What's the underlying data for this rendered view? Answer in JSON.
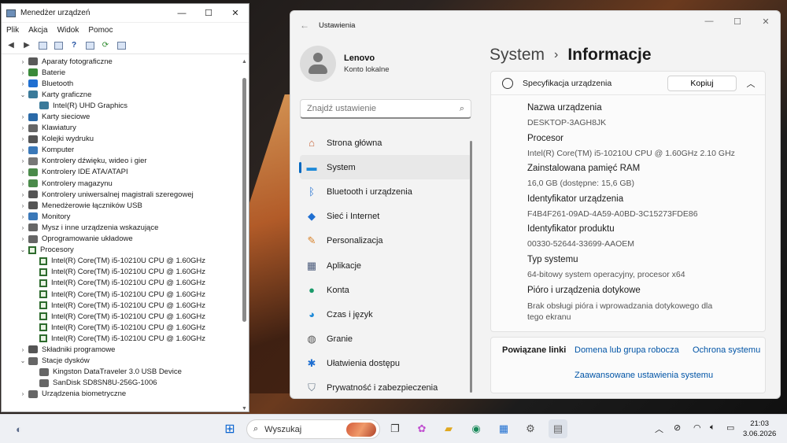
{
  "device_manager": {
    "title": "Menedżer urządzeń",
    "menu": [
      "Plik",
      "Akcja",
      "Widok",
      "Pomoc"
    ],
    "tree": [
      {
        "label": "Aparaty fotograficzne",
        "level": 0,
        "expanded": false,
        "icon": "camera-icon",
        "color": "#5a5a5a"
      },
      {
        "label": "Baterie",
        "level": 0,
        "expanded": false,
        "icon": "battery-icon",
        "color": "#3a8a3a"
      },
      {
        "label": "Bluetooth",
        "level": 0,
        "expanded": false,
        "icon": "bluetooth-icon",
        "color": "#1f6fd1"
      },
      {
        "label": "Karty graficzne",
        "level": 0,
        "expanded": true,
        "icon": "display-adapter-icon",
        "color": "#3a7a9a"
      },
      {
        "label": "Intel(R) UHD Graphics",
        "level": 1,
        "expanded": null,
        "icon": "display-adapter-icon",
        "color": "#3a7a9a"
      },
      {
        "label": "Karty sieciowe",
        "level": 0,
        "expanded": false,
        "icon": "network-icon",
        "color": "#2a6aa8"
      },
      {
        "label": "Klawiatury",
        "level": 0,
        "expanded": false,
        "icon": "keyboard-icon",
        "color": "#666666"
      },
      {
        "label": "Kolejki wydruku",
        "level": 0,
        "expanded": false,
        "icon": "printer-icon",
        "color": "#555555"
      },
      {
        "label": "Komputer",
        "level": 0,
        "expanded": false,
        "icon": "computer-icon",
        "color": "#3a78b8"
      },
      {
        "label": "Kontrolery dźwięku, wideo i gier",
        "level": 0,
        "expanded": false,
        "icon": "audio-icon",
        "color": "#777777"
      },
      {
        "label": "Kontrolery IDE ATA/ATAPI",
        "level": 0,
        "expanded": false,
        "icon": "ide-icon",
        "color": "#4a8a4a"
      },
      {
        "label": "Kontrolery magazynu",
        "level": 0,
        "expanded": false,
        "icon": "storage-controller-icon",
        "color": "#4a8a4a"
      },
      {
        "label": "Kontrolery uniwersalnej magistrali szeregowej",
        "level": 0,
        "expanded": false,
        "icon": "usb-icon",
        "color": "#555555"
      },
      {
        "label": "Menedżerowie łączników USB",
        "level": 0,
        "expanded": false,
        "icon": "usb-icon",
        "color": "#555555"
      },
      {
        "label": "Monitory",
        "level": 0,
        "expanded": false,
        "icon": "monitor-icon",
        "color": "#3a78b8"
      },
      {
        "label": "Mysz i inne urządzenia wskazujące",
        "level": 0,
        "expanded": false,
        "icon": "mouse-icon",
        "color": "#666666"
      },
      {
        "label": "Oprogramowanie układowe",
        "level": 0,
        "expanded": false,
        "icon": "firmware-icon",
        "color": "#666666"
      },
      {
        "label": "Procesory",
        "level": 0,
        "expanded": true,
        "icon": "processor-icon",
        "color": "#2d6b2d"
      },
      {
        "label": "Intel(R) Core(TM) i5-10210U CPU @ 1.60GHz",
        "level": 1,
        "expanded": null,
        "icon": "processor-icon",
        "color": "#2d6b2d"
      },
      {
        "label": "Intel(R) Core(TM) i5-10210U CPU @ 1.60GHz",
        "level": 1,
        "expanded": null,
        "icon": "processor-icon",
        "color": "#2d6b2d"
      },
      {
        "label": "Intel(R) Core(TM) i5-10210U CPU @ 1.60GHz",
        "level": 1,
        "expanded": null,
        "icon": "processor-icon",
        "color": "#2d6b2d"
      },
      {
        "label": "Intel(R) Core(TM) i5-10210U CPU @ 1.60GHz",
        "level": 1,
        "expanded": null,
        "icon": "processor-icon",
        "color": "#2d6b2d"
      },
      {
        "label": "Intel(R) Core(TM) i5-10210U CPU @ 1.60GHz",
        "level": 1,
        "expanded": null,
        "icon": "processor-icon",
        "color": "#2d6b2d"
      },
      {
        "label": "Intel(R) Core(TM) i5-10210U CPU @ 1.60GHz",
        "level": 1,
        "expanded": null,
        "icon": "processor-icon",
        "color": "#2d6b2d"
      },
      {
        "label": "Intel(R) Core(TM) i5-10210U CPU @ 1.60GHz",
        "level": 1,
        "expanded": null,
        "icon": "processor-icon",
        "color": "#2d6b2d"
      },
      {
        "label": "Intel(R) Core(TM) i5-10210U CPU @ 1.60GHz",
        "level": 1,
        "expanded": null,
        "icon": "processor-icon",
        "color": "#2d6b2d"
      },
      {
        "label": "Składniki programowe",
        "level": 0,
        "expanded": false,
        "icon": "software-component-icon",
        "color": "#555555"
      },
      {
        "label": "Stacje dysków",
        "level": 0,
        "expanded": true,
        "icon": "disk-drive-icon",
        "color": "#666666"
      },
      {
        "label": "Kingston DataTraveler 3.0 USB Device",
        "level": 1,
        "expanded": null,
        "icon": "disk-drive-icon",
        "color": "#666666"
      },
      {
        "label": "SanDisk SD8SN8U-256G-1006",
        "level": 1,
        "expanded": null,
        "icon": "disk-drive-icon",
        "color": "#666666"
      },
      {
        "label": "Urządzenia biometryczne",
        "level": 0,
        "expanded": false,
        "icon": "biometric-icon",
        "color": "#666666"
      }
    ]
  },
  "settings": {
    "title": "Ustawienia",
    "user": {
      "name": "Lenovo",
      "account_type": "Konto lokalne"
    },
    "search_placeholder": "Znajdź ustawienie",
    "nav": [
      {
        "label": "Strona główna",
        "icon": "home-icon",
        "selected": false
      },
      {
        "label": "System",
        "icon": "system-icon",
        "selected": true
      },
      {
        "label": "Bluetooth i urządzenia",
        "icon": "bluetooth-icon",
        "selected": false
      },
      {
        "label": "Sieć i Internet",
        "icon": "wifi-icon",
        "selected": false
      },
      {
        "label": "Personalizacja",
        "icon": "brush-icon",
        "selected": false
      },
      {
        "label": "Aplikacje",
        "icon": "apps-icon",
        "selected": false
      },
      {
        "label": "Konta",
        "icon": "account-icon",
        "selected": false
      },
      {
        "label": "Czas i język",
        "icon": "globe-icon",
        "selected": false
      },
      {
        "label": "Granie",
        "icon": "gamepad-icon",
        "selected": false
      },
      {
        "label": "Ułatwienia dostępu",
        "icon": "accessibility-icon",
        "selected": false
      },
      {
        "label": "Prywatność i zabezpieczenia",
        "icon": "shield-icon",
        "selected": false
      }
    ],
    "breadcrumb": {
      "parent": "System",
      "separator": "›",
      "current": "Informacje"
    },
    "spec_card": {
      "title": "Specyfikacja urządzenia",
      "copy_label": "Kopiuj",
      "items": [
        {
          "label": "Nazwa urządzenia",
          "value": "DESKTOP-3AGH8JK"
        },
        {
          "label": "Procesor",
          "value": "Intel(R) Core(TM) i5-10210U CPU @ 1.60GHz   2.10 GHz"
        },
        {
          "label": "Zainstalowana pamięć RAM",
          "value": "16,0 GB (dostępne: 15,6 GB)"
        },
        {
          "label": "Identyfikator urządzenia",
          "value": "F4B4F261-09AD-4A59-A0BD-3C15273FDE86"
        },
        {
          "label": "Identyfikator produktu",
          "value": "00330-52644-33699-AAOEM"
        },
        {
          "label": "Typ systemu",
          "value": "64-bitowy system operacyjny, procesor x64"
        },
        {
          "label": "Pióro i urządzenia dotykowe",
          "value": "Brak obsługi pióra i wprowadzania dotykowego dla tego ekranu"
        }
      ]
    },
    "related": {
      "title": "Powiązane linki",
      "links": [
        "Domena lub grupa robocza",
        "Ochrona systemu",
        "Zaawansowane ustawienia systemu"
      ]
    }
  },
  "taskbar": {
    "search_label": "Wyszukaj",
    "time": "21:03",
    "date": "3.06.2026"
  },
  "colors": {
    "accent": "#0067c0",
    "link": "#0054a6"
  }
}
